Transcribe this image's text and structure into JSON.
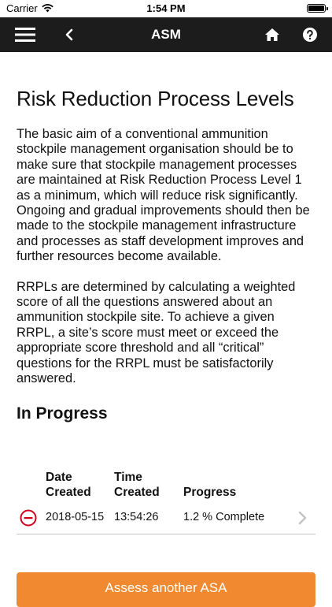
{
  "status_bar": {
    "carrier": "Carrier",
    "time": "1:54 PM"
  },
  "nav": {
    "title": "ASM",
    "icons": [
      "menu-icon",
      "chevron-left-icon",
      "home-icon",
      "help-icon"
    ]
  },
  "page": {
    "title": "Risk Reduction Process Levels",
    "paragraph_1": "The basic aim of a conventional ammunition stockpile management organisation should be to make sure that stockpile management processes are maintained at Risk Reduction Process Level 1 as a minimum, which will reduce risk significantly. Ongoing and gradual improvements should then be made to the stockpile management infrastructure and processes as staff development improves and further resources become available.",
    "paragraph_2": "RRPLs are determined by calculating a weighted score of all the questions answered about an ammunition stockpile site. To achieve a given RRPL, a site’s score must meet or exceed the appropriate score threshold and all “critical” questions for the RRPL must be satisfactorily answered."
  },
  "in_progress": {
    "title": "In Progress",
    "columns": {
      "date_line1": "Date",
      "date_line2": "Created",
      "time_line1": "Time",
      "time_line2": "Created",
      "progress": "Progress"
    },
    "rows": [
      {
        "date": "2018-05-15",
        "time": "13:54:26",
        "progress": "1.2 % Complete"
      }
    ]
  },
  "actions": {
    "assess_label": "Assess another ASA"
  },
  "colors": {
    "nav_background": "#1c1c1c",
    "accent": "#f0892f",
    "delete": "#d0021b"
  }
}
